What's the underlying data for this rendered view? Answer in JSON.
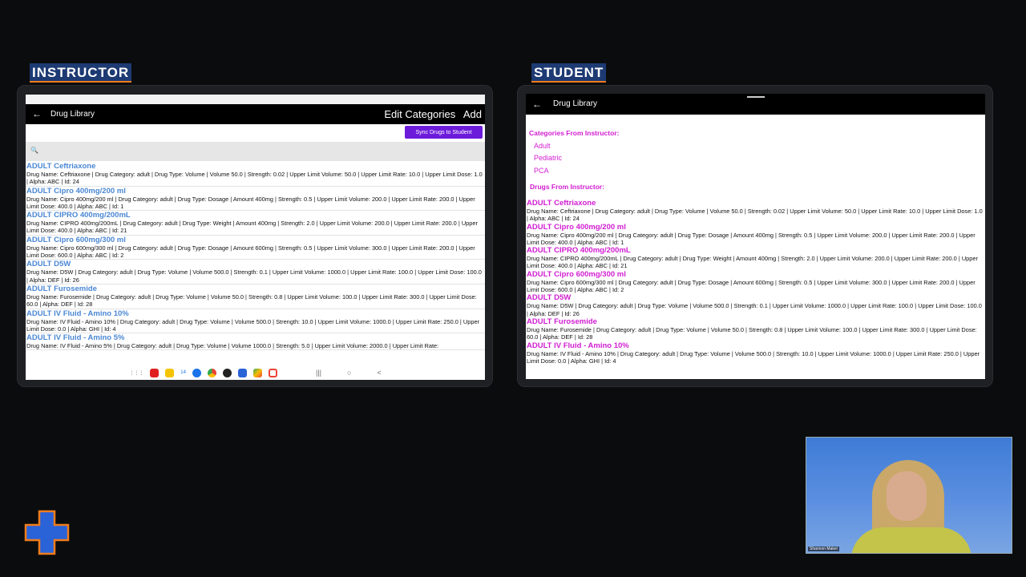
{
  "instructor": {
    "label": "INSTRUCTOR",
    "app_title": "Drug Library",
    "back_icon": "←",
    "actions": [
      "Edit Categories",
      "Add"
    ],
    "sync_button": "Sync Drugs to Student",
    "search_icon": "🔍",
    "drugs": [
      {
        "name": "ADULT Ceftriaxone",
        "details": "Drug Name: Ceftriaxone | Drug Category: adult | Drug Type: Volume | Volume 50.0 | Strength: 0.02 | Upper Limit Volume: 50.0 | Upper Limit Rate: 10.0 | Upper Limit Dose: 1.0 | Alpha: ABC | Id: 24"
      },
      {
        "name": "ADULT Cipro 400mg/200 ml",
        "details": "Drug Name: Cipro 400mg/200 ml | Drug Category: adult | Drug Type: Dosage | Amount 400mg | Strength: 0.5 | Upper Limit Volume: 200.0 | Upper Limit Rate: 200.0 | Upper Limit Dose: 400.0 | Alpha: ABC | Id: 1"
      },
      {
        "name": "ADULT CIPRO 400mg/200mL",
        "details": "Drug Name: CIPRO 400mg/200mL | Drug Category: adult | Drug Type: Weight | Amount 400mg | Strength: 2.0 | Upper Limit Volume: 200.0 | Upper Limit Rate: 200.0 | Upper Limit Dose: 400.0 | Alpha: ABC | Id: 21"
      },
      {
        "name": "ADULT Cipro 600mg/300 ml",
        "details": "Drug Name: Cipro 600mg/300 ml | Drug Category: adult | Drug Type: Dosage | Amount 600mg | Strength: 0.5 | Upper Limit Volume: 300.0 | Upper Limit Rate: 200.0 | Upper Limit Dose: 600.0 | Alpha: ABC | Id: 2"
      },
      {
        "name": "ADULT D5W",
        "details": "Drug Name: D5W | Drug Category: adult | Drug Type: Volume | Volume 500.0 | Strength: 0.1 | Upper Limit Volume: 1000.0 | Upper Limit Rate: 100.0 | Upper Limit Dose: 100.0 | Alpha: DEF | Id: 26"
      },
      {
        "name": "ADULT Furosemide",
        "details": "Drug Name: Furosemide | Drug Category: adult | Drug Type: Volume | Volume 50.0 | Strength: 0.8 | Upper Limit Volume: 100.0 | Upper Limit Rate: 300.0 | Upper Limit Dose: 60.0 | Alpha: DEF | Id: 28"
      },
      {
        "name": "ADULT IV Fluid - Amino 10%",
        "details": "Drug Name: IV Fluid - Amino 10% | Drug Category: adult | Drug Type: Volume | Volume 500.0 | Strength: 10.0 | Upper Limit Volume: 1000.0 | Upper Limit Rate: 250.0 | Upper Limit Dose: 0.0 | Alpha: GHI | Id: 4"
      },
      {
        "name": "ADULT IV Fluid - Amino 5%",
        "details": "Drug Name: IV Fluid - Amino 5% | Drug Category: adult | Drug Type: Volume | Volume 1000.0 | Strength: 5.0 | Upper Limit Volume: 2000.0 | Upper Limit Rate:"
      }
    ],
    "navbar": {
      "apps_icon": "⋮⋮⋮",
      "recents_icon": "|||",
      "home_icon": "○",
      "back_icon": "<",
      "calendar_badge": "14"
    }
  },
  "student": {
    "label": "STUDENT",
    "app_title": "Drug Library",
    "back_icon": "←",
    "categories_title": "Categories From Instructor:",
    "categories": [
      "Adult",
      "Pediatric",
      "PCA"
    ],
    "drugs_title": "Drugs From Instructor:",
    "drugs": [
      {
        "name": "ADULT Ceftriaxone",
        "details": "Drug Name: Ceftriaxone | Drug Category: adult | Drug Type: Volume | Volume 50.0 | Strength: 0.02 | Upper Limit Volume: 50.0 | Upper Limit Rate: 10.0 | Upper Limit Dose: 1.0 | Alpha: ABC | Id: 24"
      },
      {
        "name": "ADULT Cipro 400mg/200 ml",
        "details": "Drug Name: Cipro 400mg/200 ml | Drug Category: adult | Drug Type: Dosage | Amount 400mg | Strength: 0.5 | Upper Limit Volume: 200.0 | Upper Limit Rate: 200.0 | Upper Limit Dose: 400.0 | Alpha: ABC | Id: 1"
      },
      {
        "name": "ADULT CIPRO 400mg/200mL",
        "details": "Drug Name: CIPRO 400mg/200mL | Drug Category: adult | Drug Type: Weight | Amount 400mg | Strength: 2.0 | Upper Limit Volume: 200.0 | Upper Limit Rate: 200.0 | Upper Limit Dose: 400.0 | Alpha: ABC | Id: 21"
      },
      {
        "name": "ADULT Cipro 600mg/300 ml",
        "details": "Drug Name: Cipro 600mg/300 ml | Drug Category: adult | Drug Type: Dosage | Amount 600mg | Strength: 0.5 | Upper Limit Volume: 300.0 | Upper Limit Rate: 200.0 | Upper Limit Dose: 600.0 | Alpha: ABC | Id: 2"
      },
      {
        "name": "ADULT D5W",
        "details": "Drug Name: D5W | Drug Category: adult | Drug Type: Volume | Volume 500.0 | Strength: 0.1 | Upper Limit Volume: 1000.0 | Upper Limit Rate: 100.0 | Upper Limit Dose: 100.0 | Alpha: DEF | Id: 26"
      },
      {
        "name": "ADULT Furosemide",
        "details": "Drug Name: Furosemide | Drug Category: adult | Drug Type: Volume | Volume 50.0 | Strength: 0.8 | Upper Limit Volume: 100.0 | Upper Limit Rate: 300.0 | Upper Limit Dose: 60.0 | Alpha: DEF | Id: 28"
      },
      {
        "name": "ADULT IV Fluid - Amino 10%",
        "details": "Drug Name: IV Fluid - Amino 10% | Drug Category: adult | Drug Type: Volume | Volume 500.0 | Strength: 10.0 | Upper Limit Volume: 1000.0 | Upper Limit Rate: 250.0 | Upper Limit Dose: 0.0 | Alpha: GHI | Id: 4"
      }
    ]
  },
  "webcam": {
    "name_tag": "Shannon Makel"
  },
  "colors": {
    "instructor_drug_name": "#4a87d4",
    "student_magenta": "#d21dd2",
    "sync_button": "#6d1bdb",
    "label_bg": "#1d3a73",
    "label_accent": "#f07d1a",
    "logo_blue": "#2a62d8",
    "logo_orange": "#f07d1a"
  }
}
